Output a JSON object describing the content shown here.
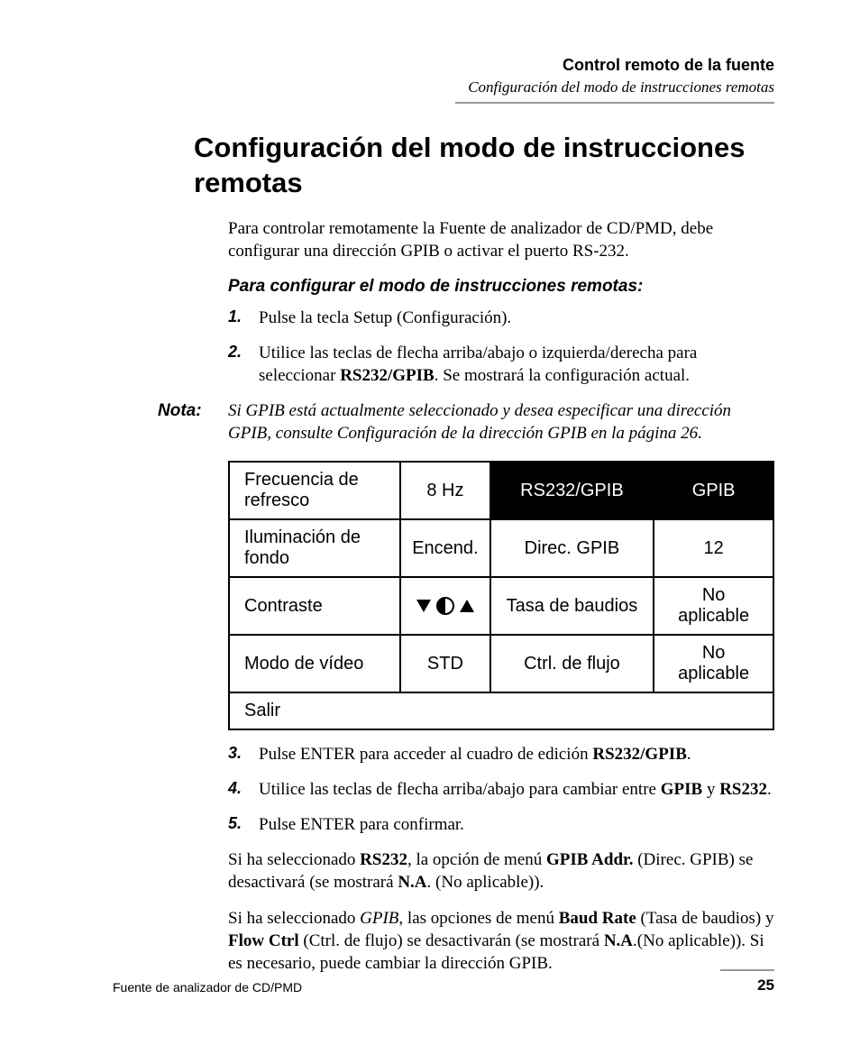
{
  "header": {
    "chapter": "Control remoto de la fuente",
    "section": "Configuración del modo de instrucciones remotas"
  },
  "title": "Configuración del modo de instrucciones remotas",
  "intro": "Para controlar remotamente la Fuente de analizador de CD/PMD, debe configurar una dirección GPIB o activar el puerto RS-232.",
  "subhead": "Para configurar el modo de instrucciones remotas:",
  "steps_a": {
    "s1": {
      "num": "1.",
      "text": "Pulse la tecla Setup (Configuración)."
    },
    "s2": {
      "num": "2.",
      "pre": "Utilice las teclas de flecha arriba/abajo o izquierda/derecha para seleccionar ",
      "bold": "RS232/GPIB",
      "post": ". Se mostrará la configuración actual."
    }
  },
  "note": {
    "label": "Nota:",
    "text_pre": "Si GPIB está actualmente seleccionado y desea especificar una dirección GPIB, consulte ",
    "text_link": "Configuración de la dirección GPIB",
    "text_post": " en la página 26."
  },
  "table": {
    "r1": {
      "c1": "Frecuencia de refresco",
      "c2": "8 Hz",
      "c3": "RS232/GPIB",
      "c4": "GPIB"
    },
    "r2": {
      "c1": "Iluminación de fondo",
      "c2": "Encend.",
      "c3": "Direc. GPIB",
      "c4": "12"
    },
    "r3": {
      "c1": "Contraste",
      "c3": "Tasa de baudios",
      "c4": "No aplicable"
    },
    "r4": {
      "c1": "Modo de vídeo",
      "c2": "STD",
      "c3": "Ctrl. de flujo",
      "c4": "No aplicable"
    },
    "r5": {
      "c1": "Salir"
    }
  },
  "steps_b": {
    "s3": {
      "num": "3.",
      "pre": "Pulse ENTER para acceder al cuadro de edición ",
      "bold": "RS232/GPIB",
      "post": "."
    },
    "s4": {
      "num": "4.",
      "pre": "Utilice las teclas de flecha arriba/abajo para cambiar entre ",
      "b1": "GPIB",
      "mid": " y ",
      "b2": "RS232",
      "post": "."
    },
    "s5": {
      "num": "5.",
      "text": "Pulse ENTER para confirmar."
    }
  },
  "para1": {
    "t1": "Si ha seleccionado ",
    "b1": "RS232",
    "t2": ", la opción de menú ",
    "b2": "GPIB Addr.",
    "t3": " (Direc. GPIB) se desactivará (se mostrará ",
    "b3": "N.A",
    "t4": ". (No aplicable))."
  },
  "para2": {
    "t1": "Si ha seleccionado ",
    "i1": "GPIB",
    "t2": ", las opciones de menú ",
    "b1": "Baud Rate",
    "t3": " (Tasa de baudios) y ",
    "b2": "Flow Ctrl",
    "t4": " (Ctrl. de flujo) se desactivarán (se mostrará ",
    "b3": "N.A",
    "t5": ".(No aplicable)). Si es necesario, puede cambiar la dirección GPIB."
  },
  "footer": {
    "doc": "Fuente de analizador de CD/PMD",
    "page": "25"
  }
}
